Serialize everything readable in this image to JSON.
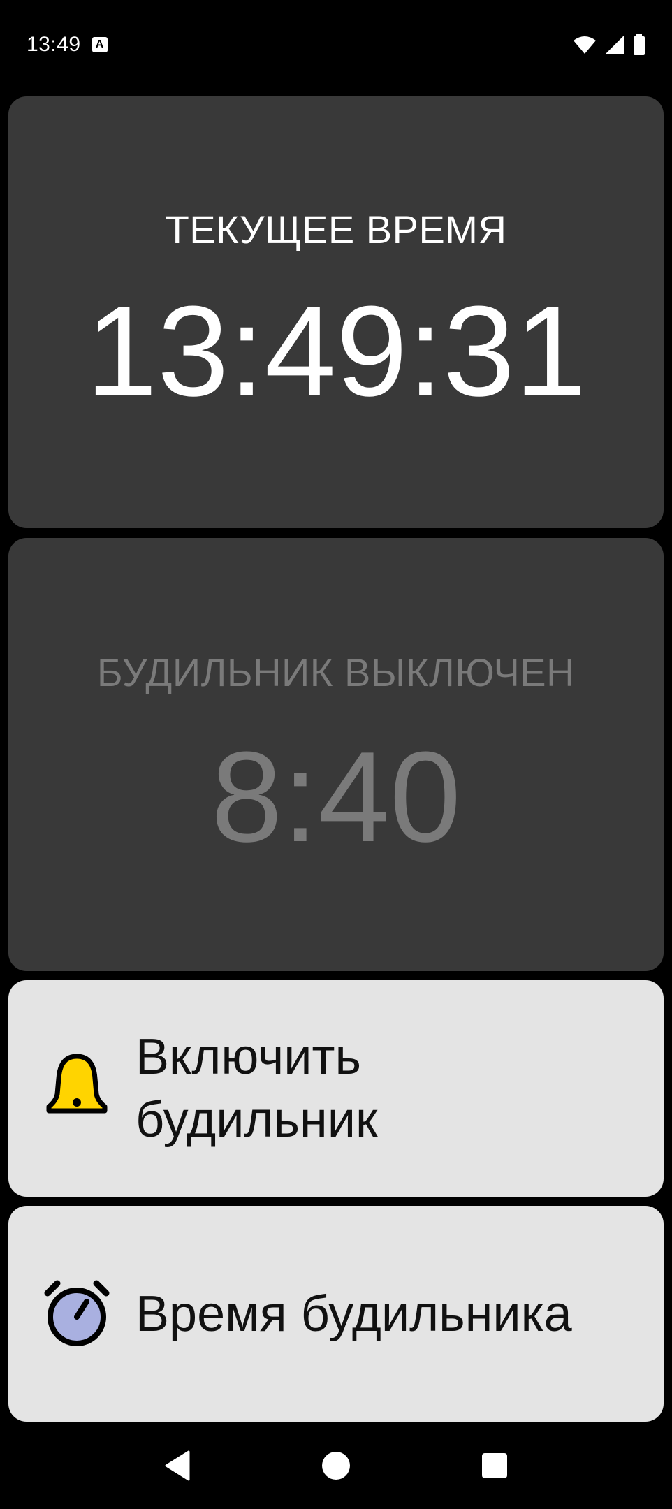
{
  "status_bar": {
    "time": "13:49",
    "notification_icon": "a-letter-icon",
    "icons": [
      "wifi-icon",
      "signal-icon",
      "battery-icon"
    ]
  },
  "current_time": {
    "label": "ТЕКУЩЕЕ ВРЕМЯ",
    "value": "13:49:31"
  },
  "alarm": {
    "status_label": "БУДИЛЬНИК ВЫКЛЮЧЕН",
    "time": "8:40"
  },
  "actions": {
    "enable_alarm": {
      "line1": "Включить",
      "line2": "будильник",
      "icon": "bell-icon",
      "icon_color": "#FFD400"
    },
    "set_alarm_time": {
      "label": "Время будильника",
      "icon": "alarm-clock-icon",
      "icon_color": "#A9B0E0"
    }
  },
  "nav_bar": {
    "buttons": [
      "back-icon",
      "home-icon",
      "recents-icon"
    ]
  },
  "colors": {
    "background": "#000000",
    "dark_card": "#393939",
    "light_card": "#E4E4E4",
    "disabled_text": "#7A7A7A"
  }
}
